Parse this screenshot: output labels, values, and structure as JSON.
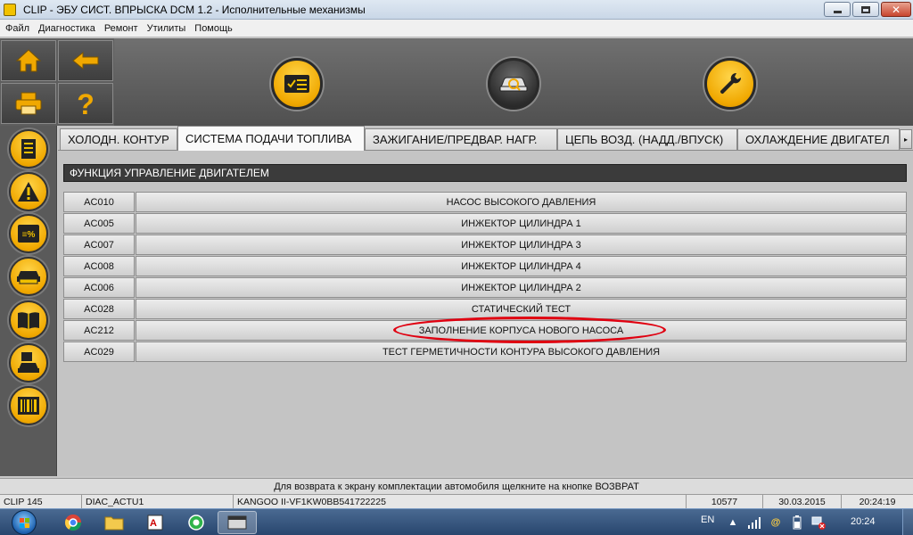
{
  "window": {
    "title": "CLIP - ЭБУ СИСТ. ВПРЫСКА DCM 1.2 - Исполнительные механизмы",
    "app_icon": "clip-app-icon",
    "controls": {
      "minimize_icon": "minimize-icon",
      "maximize_icon": "restore-icon",
      "close_icon": "close-icon"
    }
  },
  "menu": {
    "items": [
      "Файл",
      "Диагностика",
      "Ремонт",
      "Утилиты",
      "Помощь"
    ]
  },
  "toolbar_left": {
    "home_icon": "home-icon",
    "back_icon": "back-arrow-icon",
    "print_icon": "printer-icon",
    "help_icon": "question-mark-icon"
  },
  "toolbar_top": {
    "buttons": [
      {
        "icon": "checklist-icon",
        "style": "yellow"
      },
      {
        "icon": "car-diagnostic-icon",
        "style": "dark"
      },
      {
        "icon": "wrench-icon",
        "style": "yellow"
      }
    ]
  },
  "sidebar": {
    "buttons": [
      "document-icon",
      "warning-icon",
      "parameters-percent-icon",
      "vehicle-config-icon",
      "manual-book-icon",
      "vehicle-save-icon",
      "barcode-icon"
    ]
  },
  "tabs": {
    "items": [
      {
        "label": "ХОЛОДН. КОНТУР",
        "active": false
      },
      {
        "label": "СИСТЕМА ПОДАЧИ ТОПЛИВА",
        "active": true
      },
      {
        "label": "ЗАЖИГАНИЕ/ПРЕДВАР. НАГР.",
        "active": false
      },
      {
        "label": "ЦЕПЬ ВОЗД. (НАДД./ВПУСК)",
        "active": false
      },
      {
        "label": "ОХЛАЖДЕНИЕ ДВИГАТЕЛ",
        "active": false
      }
    ],
    "scroll_icon": "chevron-right-icon"
  },
  "section": {
    "title": "ФУНКЦИЯ УПРАВЛЕНИЕ ДВИГАТЕЛЕМ"
  },
  "actuators": [
    {
      "code": "AC010",
      "name": "НАСОС ВЫСОКОГО ДАВЛЕНИЯ"
    },
    {
      "code": "AC005",
      "name": "ИНЖЕКТОР ЦИЛИНДРА 1"
    },
    {
      "code": "AC007",
      "name": "ИНЖЕКТОР ЦИЛИНДРА 3"
    },
    {
      "code": "AC008",
      "name": "ИНЖЕКТОР ЦИЛИНДРА 4"
    },
    {
      "code": "AC006",
      "name": "ИНЖЕКТОР ЦИЛИНДРА 2"
    },
    {
      "code": "AC028",
      "name": "СТАТИЧЕСКИЙ ТЕСТ"
    },
    {
      "code": "AC212",
      "name": "ЗАПОЛНЕНИЕ КОРПУСА НОВОГО НАСОСА"
    },
    {
      "code": "AC029",
      "name": "ТЕСТ ГЕРМЕТИЧНОСТИ КОНТУРА ВЫСОКОГО ДАВЛЕНИЯ"
    }
  ],
  "annotation": {
    "color": "#e00010"
  },
  "hint": "Для возврата к экрану комплектации автомобиля щелкните на кнопке ВОЗВРАТ",
  "status": {
    "clip_version": "CLIP 145",
    "diag": "DIAC_ACTU1",
    "vehicle": "KANGOO II-VF1KW0BB541722225",
    "code": "10577",
    "date": "30.03.2015",
    "time": "20:24:19"
  },
  "taskbar": {
    "apps": [
      "chrome-icon",
      "file-explorer-icon",
      "translator-icon",
      "messenger-icon",
      "clip-window-icon"
    ],
    "lang": "EN",
    "tray_icons": [
      "arrow-up-icon",
      "signal-bars-icon",
      "at-sign-icon",
      "battery-icon",
      "network-error-icon"
    ],
    "clock": "20:24"
  },
  "colors": {
    "accent_yellow": "#f0a800",
    "dark_panel": "#3b3b3b",
    "annotation_red": "#e00010"
  }
}
